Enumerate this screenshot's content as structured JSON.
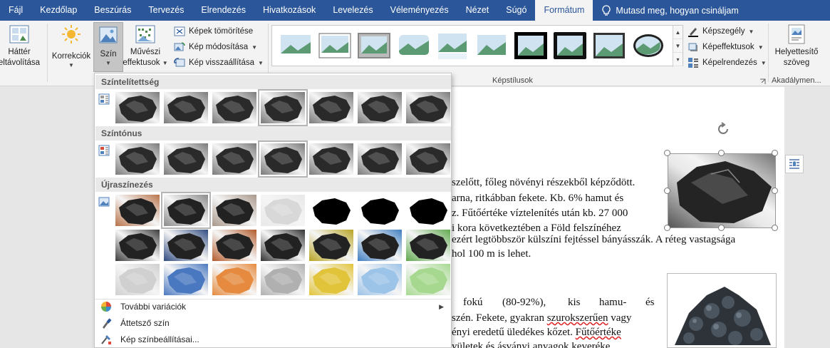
{
  "tabs": [
    {
      "id": "fajl",
      "label": "Fájl"
    },
    {
      "id": "kezdolap",
      "label": "Kezdőlap"
    },
    {
      "id": "beszuras",
      "label": "Beszúrás"
    },
    {
      "id": "tervezes",
      "label": "Tervezés"
    },
    {
      "id": "elrendezes",
      "label": "Elrendezés"
    },
    {
      "id": "hivatkozasok",
      "label": "Hivatkozások"
    },
    {
      "id": "levelezes",
      "label": "Levelezés"
    },
    {
      "id": "velemenyezes",
      "label": "Véleményezés"
    },
    {
      "id": "nezet",
      "label": "Nézet"
    },
    {
      "id": "sugo",
      "label": "Súgó"
    },
    {
      "id": "formatum",
      "label": "Formátum",
      "active": true
    }
  ],
  "tell_me": {
    "icon": "lightbulb-icon",
    "text": "Mutasd meg, hogyan csináljam"
  },
  "ribbon": {
    "remove_bg": {
      "line1": "Háttér",
      "line2": "eltávolítása",
      "icon": "remove-background-icon"
    },
    "corrections": {
      "label": "Korrekciók",
      "icon": "sun-icon"
    },
    "color": {
      "label": "Szín",
      "icon": "picture-color-icon"
    },
    "artistic": {
      "line1": "Művészi",
      "line2": "effektusok",
      "icon": "artistic-effects-icon"
    },
    "compress": {
      "label": "Képek tömörítése",
      "icon": "compress-icon"
    },
    "change": {
      "label": "Kép módosítása",
      "icon": "change-picture-icon"
    },
    "reset": {
      "label": "Kép visszaállítása",
      "icon": "reset-picture-icon"
    },
    "picture_styles_label": "Képstílusok",
    "border": {
      "label": "Képszegély",
      "icon": "picture-border-icon"
    },
    "effects": {
      "label": "Képeffektusok",
      "icon": "picture-effects-icon"
    },
    "layout": {
      "label": "Képelrendezés",
      "icon": "picture-layout-icon"
    },
    "alt_text": {
      "line1": "Helyettesítő",
      "line2": "szöveg",
      "icon": "alt-text-icon"
    },
    "accessibility_label": "Akadálymen..."
  },
  "dropdown": {
    "saturation_title": "Színtelítettség",
    "tone_title": "Színtónus",
    "recolor_title": "Újraszínezés",
    "more_variations": "További variációk",
    "transparent": "Áttetsző szín",
    "options": "Kép színbeállításai..."
  },
  "colors": {
    "tab_bar": "#2b579a",
    "ribbon_bg": "#f3f3f3",
    "recolor_rows": [
      [
        "#b8734a",
        "#8a8a8a",
        "#a8978a",
        "#ebebeb",
        "#000000",
        "#000000",
        "#000000"
      ],
      [
        "#3c3c3c",
        "#2e4a7f",
        "#b35a2a",
        "#333333",
        "#b8a423",
        "#3f7ec1",
        "#5fa84d"
      ],
      [
        "#d0d0d0",
        "#4a78c0",
        "#e58a3e",
        "#b0b0b0",
        "#e2c43a",
        "#9cc3e8",
        "#a6d98f"
      ]
    ]
  },
  "document": {
    "lines1": [
      "szelőtt, főleg növényi részekből képződött.",
      "arna, ritkábban fekete. Kb. 6% hamut és",
      "z. Fűtőértéke víztelenítés után kb. 27 000",
      "i kora következtében a Föld felszínéhez",
      "ezért legtöbbször külszíni fejtéssel bányásszák. A réteg vastagsága",
      "hol 100 m is lehet."
    ],
    "p2_line1_a": "fokú",
    "p2_line1_b": "(80-92%),",
    "p2_line1_c": "kis",
    "p2_line1_d": "hamu-",
    "p2_line1_e": "és",
    "p2_line2_a": "szén. Fekete, gyakran ",
    "p2_line2_squiggle": "szurokszerűen",
    "p2_line2_b": " vagy",
    "p2_line3_a": "ényi eredetű üledékes kőzet. ",
    "p2_line3_squiggle": "Fűtőértéke",
    "p2_line4": "yületek és ásványi anyagok keveréke."
  }
}
